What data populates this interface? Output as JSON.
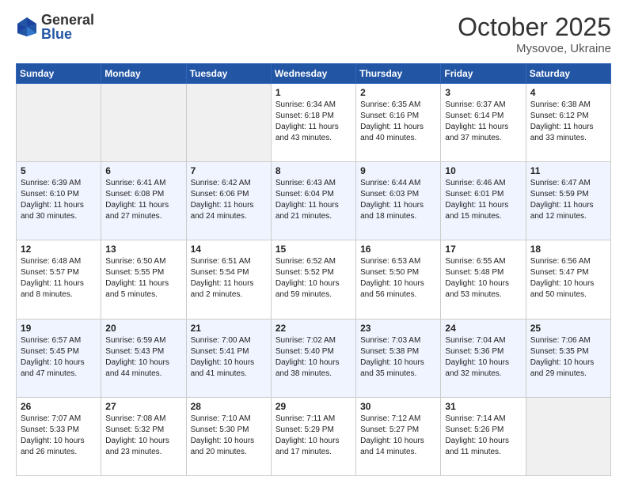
{
  "header": {
    "logo_general": "General",
    "logo_blue": "Blue",
    "month_title": "October 2025",
    "location": "Mysovoe, Ukraine"
  },
  "weekdays": [
    "Sunday",
    "Monday",
    "Tuesday",
    "Wednesday",
    "Thursday",
    "Friday",
    "Saturday"
  ],
  "weeks": [
    [
      {
        "day": "",
        "info": ""
      },
      {
        "day": "",
        "info": ""
      },
      {
        "day": "",
        "info": ""
      },
      {
        "day": "1",
        "info": "Sunrise: 6:34 AM\nSunset: 6:18 PM\nDaylight: 11 hours\nand 43 minutes."
      },
      {
        "day": "2",
        "info": "Sunrise: 6:35 AM\nSunset: 6:16 PM\nDaylight: 11 hours\nand 40 minutes."
      },
      {
        "day": "3",
        "info": "Sunrise: 6:37 AM\nSunset: 6:14 PM\nDaylight: 11 hours\nand 37 minutes."
      },
      {
        "day": "4",
        "info": "Sunrise: 6:38 AM\nSunset: 6:12 PM\nDaylight: 11 hours\nand 33 minutes."
      }
    ],
    [
      {
        "day": "5",
        "info": "Sunrise: 6:39 AM\nSunset: 6:10 PM\nDaylight: 11 hours\nand 30 minutes."
      },
      {
        "day": "6",
        "info": "Sunrise: 6:41 AM\nSunset: 6:08 PM\nDaylight: 11 hours\nand 27 minutes."
      },
      {
        "day": "7",
        "info": "Sunrise: 6:42 AM\nSunset: 6:06 PM\nDaylight: 11 hours\nand 24 minutes."
      },
      {
        "day": "8",
        "info": "Sunrise: 6:43 AM\nSunset: 6:04 PM\nDaylight: 11 hours\nand 21 minutes."
      },
      {
        "day": "9",
        "info": "Sunrise: 6:44 AM\nSunset: 6:03 PM\nDaylight: 11 hours\nand 18 minutes."
      },
      {
        "day": "10",
        "info": "Sunrise: 6:46 AM\nSunset: 6:01 PM\nDaylight: 11 hours\nand 15 minutes."
      },
      {
        "day": "11",
        "info": "Sunrise: 6:47 AM\nSunset: 5:59 PM\nDaylight: 11 hours\nand 12 minutes."
      }
    ],
    [
      {
        "day": "12",
        "info": "Sunrise: 6:48 AM\nSunset: 5:57 PM\nDaylight: 11 hours\nand 8 minutes."
      },
      {
        "day": "13",
        "info": "Sunrise: 6:50 AM\nSunset: 5:55 PM\nDaylight: 11 hours\nand 5 minutes."
      },
      {
        "day": "14",
        "info": "Sunrise: 6:51 AM\nSunset: 5:54 PM\nDaylight: 11 hours\nand 2 minutes."
      },
      {
        "day": "15",
        "info": "Sunrise: 6:52 AM\nSunset: 5:52 PM\nDaylight: 10 hours\nand 59 minutes."
      },
      {
        "day": "16",
        "info": "Sunrise: 6:53 AM\nSunset: 5:50 PM\nDaylight: 10 hours\nand 56 minutes."
      },
      {
        "day": "17",
        "info": "Sunrise: 6:55 AM\nSunset: 5:48 PM\nDaylight: 10 hours\nand 53 minutes."
      },
      {
        "day": "18",
        "info": "Sunrise: 6:56 AM\nSunset: 5:47 PM\nDaylight: 10 hours\nand 50 minutes."
      }
    ],
    [
      {
        "day": "19",
        "info": "Sunrise: 6:57 AM\nSunset: 5:45 PM\nDaylight: 10 hours\nand 47 minutes."
      },
      {
        "day": "20",
        "info": "Sunrise: 6:59 AM\nSunset: 5:43 PM\nDaylight: 10 hours\nand 44 minutes."
      },
      {
        "day": "21",
        "info": "Sunrise: 7:00 AM\nSunset: 5:41 PM\nDaylight: 10 hours\nand 41 minutes."
      },
      {
        "day": "22",
        "info": "Sunrise: 7:02 AM\nSunset: 5:40 PM\nDaylight: 10 hours\nand 38 minutes."
      },
      {
        "day": "23",
        "info": "Sunrise: 7:03 AM\nSunset: 5:38 PM\nDaylight: 10 hours\nand 35 minutes."
      },
      {
        "day": "24",
        "info": "Sunrise: 7:04 AM\nSunset: 5:36 PM\nDaylight: 10 hours\nand 32 minutes."
      },
      {
        "day": "25",
        "info": "Sunrise: 7:06 AM\nSunset: 5:35 PM\nDaylight: 10 hours\nand 29 minutes."
      }
    ],
    [
      {
        "day": "26",
        "info": "Sunrise: 7:07 AM\nSunset: 5:33 PM\nDaylight: 10 hours\nand 26 minutes."
      },
      {
        "day": "27",
        "info": "Sunrise: 7:08 AM\nSunset: 5:32 PM\nDaylight: 10 hours\nand 23 minutes."
      },
      {
        "day": "28",
        "info": "Sunrise: 7:10 AM\nSunset: 5:30 PM\nDaylight: 10 hours\nand 20 minutes."
      },
      {
        "day": "29",
        "info": "Sunrise: 7:11 AM\nSunset: 5:29 PM\nDaylight: 10 hours\nand 17 minutes."
      },
      {
        "day": "30",
        "info": "Sunrise: 7:12 AM\nSunset: 5:27 PM\nDaylight: 10 hours\nand 14 minutes."
      },
      {
        "day": "31",
        "info": "Sunrise: 7:14 AM\nSunset: 5:26 PM\nDaylight: 10 hours\nand 11 minutes."
      },
      {
        "day": "",
        "info": ""
      }
    ]
  ]
}
